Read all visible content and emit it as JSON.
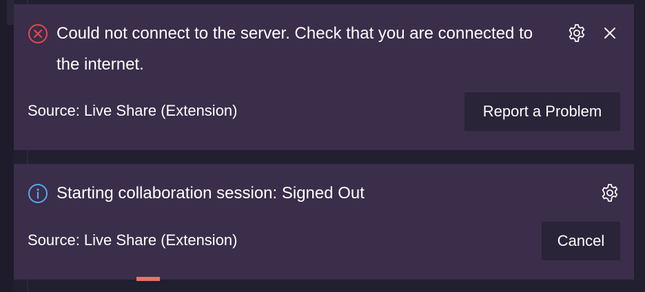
{
  "notifications": [
    {
      "type": "error",
      "status_icon": "error-circle-icon",
      "message": "Could not connect to the server. Check that you are connected to the internet.",
      "source": "Source: Live Share (Extension)",
      "action_label": "Report a Problem",
      "icons": [
        "gear-icon",
        "close-icon"
      ]
    },
    {
      "type": "info",
      "status_icon": "info-circle-icon",
      "message": "Starting collaboration session: Signed Out",
      "source": "Source: Live Share (Extension)",
      "action_label": "Cancel",
      "icons": [
        "gear-icon"
      ]
    }
  ],
  "colors": {
    "background": "#221f30",
    "toast_background": "#3a2e4a",
    "button_background": "#2a2438",
    "error": "#e5484d",
    "info": "#5aa7e8",
    "text": "#ffffff"
  }
}
